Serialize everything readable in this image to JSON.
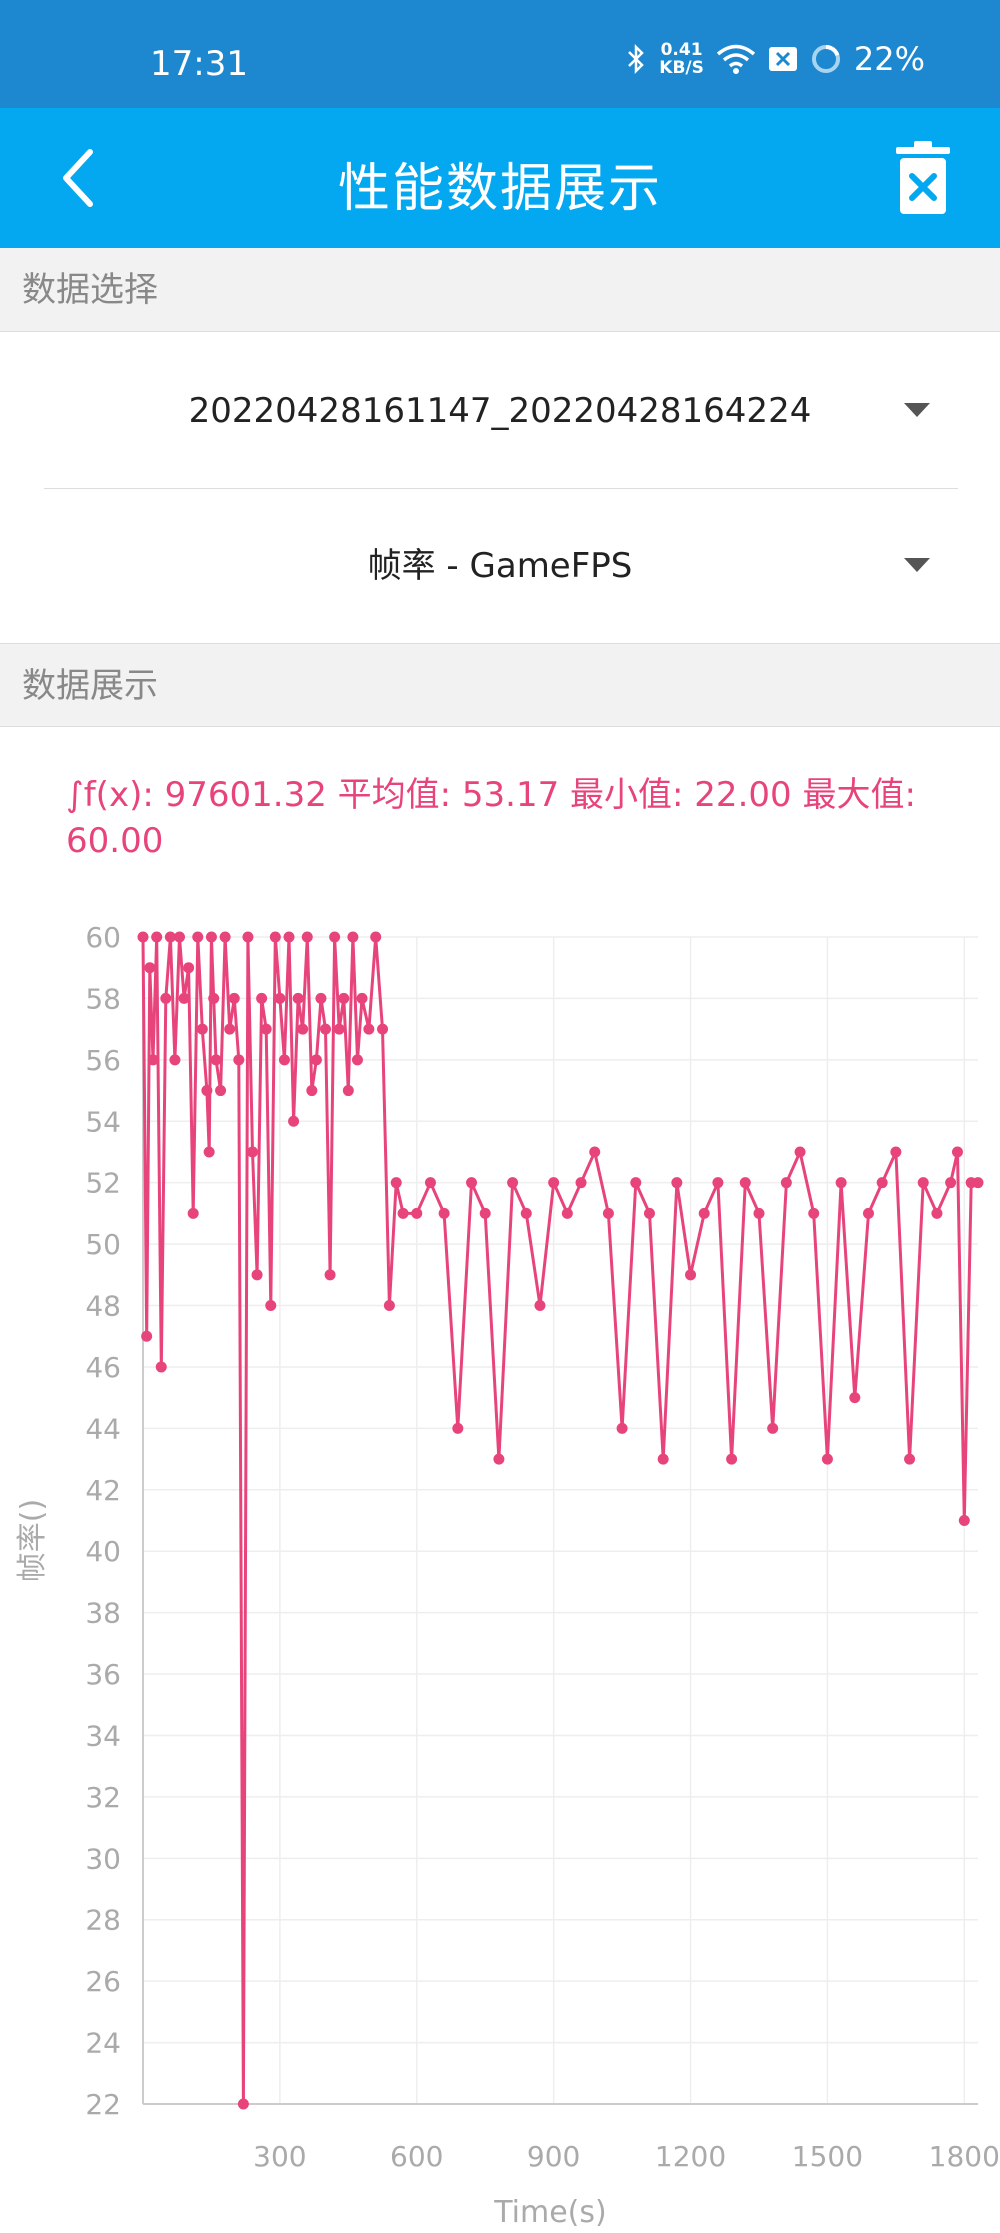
{
  "status_bar": {
    "time": "17:31",
    "net_speed_value": "0.41",
    "net_speed_unit": "KB/S",
    "battery": "22%",
    "icons": [
      "bluetooth-icon",
      "wifi-icon",
      "sim-icon",
      "battery-ring-icon"
    ]
  },
  "app_bar": {
    "title": "性能数据展示",
    "back_icon": "chevron-left-icon",
    "delete_icon": "trash-icon"
  },
  "data_select": {
    "header": "数据选择",
    "session": "20220428161147_20220428164224",
    "metric": "帧率 - GameFPS"
  },
  "data_display": {
    "header": "数据展示",
    "summary": "∫f(x): 97601.32 平均值: 53.17 最小值: 22.00 最大值: 60.00"
  },
  "colors": {
    "status_bar": "#1d88cf",
    "app_bar": "#04a8f0",
    "series": "#e8447c",
    "axis_text": "#aaaaaa",
    "grid": "#eeeeee"
  },
  "chart_data": {
    "type": "line",
    "title": "",
    "xlabel": "Time(s)",
    "ylabel": "帧率()",
    "xlim": [
      0,
      1830
    ],
    "ylim": [
      22,
      60
    ],
    "x_ticks": [
      300,
      600,
      900,
      1200,
      1500,
      1800
    ],
    "y_ticks": [
      22,
      24,
      26,
      28,
      30,
      32,
      34,
      36,
      38,
      40,
      42,
      44,
      46,
      48,
      50,
      52,
      54,
      56,
      58,
      60
    ],
    "grid": true,
    "legend": "none",
    "series": [
      {
        "values_x": [
          0,
          8,
          15,
          22,
          30,
          40,
          50,
          60,
          70,
          80,
          90,
          100,
          110,
          120,
          130,
          140,
          145,
          150,
          155,
          160,
          170,
          180,
          190,
          200,
          210,
          220,
          230,
          240,
          250,
          260,
          270,
          280,
          290,
          300,
          310,
          320,
          330,
          340,
          350,
          360,
          370,
          380,
          390,
          400,
          410,
          420,
          430,
          440,
          450,
          460,
          470,
          480,
          495,
          510,
          525,
          540,
          555,
          570,
          600,
          630,
          660,
          690,
          720,
          750,
          780,
          810,
          840,
          870,
          900,
          930,
          960,
          990,
          1020,
          1050,
          1080,
          1110,
          1140,
          1170,
          1200,
          1230,
          1260,
          1290,
          1320,
          1350,
          1380,
          1410,
          1440,
          1470,
          1500,
          1530,
          1560,
          1590,
          1620,
          1650,
          1680,
          1710,
          1740,
          1770,
          1785,
          1800,
          1815,
          1830
        ],
        "values_y": [
          60,
          47,
          59,
          56,
          60,
          46,
          58,
          60,
          56,
          60,
          58,
          59,
          51,
          60,
          57,
          55,
          53,
          60,
          58,
          56,
          55,
          60,
          57,
          58,
          56,
          22,
          60,
          53,
          49,
          58,
          57,
          48,
          60,
          58,
          56,
          60,
          54,
          58,
          57,
          60,
          55,
          56,
          58,
          57,
          49,
          60,
          57,
          58,
          55,
          60,
          56,
          58,
          57,
          60,
          57,
          48,
          52,
          51,
          51,
          52,
          51,
          44,
          52,
          51,
          43,
          52,
          51,
          48,
          52,
          51,
          52,
          53,
          51,
          44,
          52,
          51,
          43,
          52,
          49,
          51,
          52,
          43,
          52,
          51,
          44,
          52,
          53,
          51,
          43,
          52,
          45,
          51,
          52,
          53,
          43,
          52,
          51,
          52,
          53,
          41,
          52,
          52
        ]
      }
    ]
  }
}
